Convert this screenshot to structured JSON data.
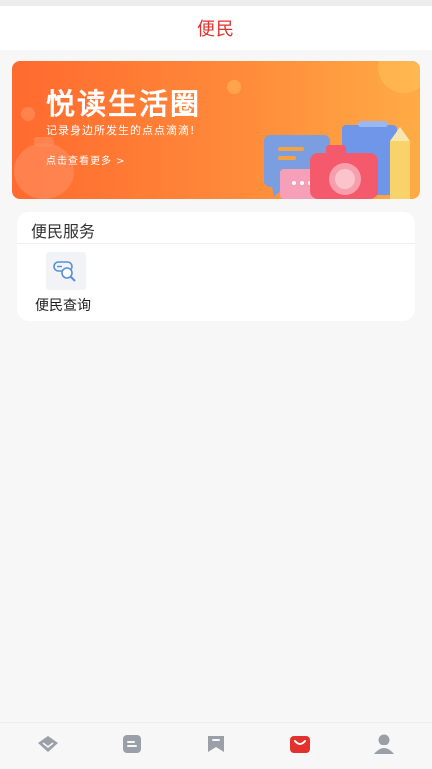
{
  "header": {
    "title": "便民"
  },
  "banner": {
    "headline": "悦读生活圈",
    "subtitle": "记录身边所发生的点点滴滴!",
    "more_link": "点击查看更多 >"
  },
  "section": {
    "title": "便民服务",
    "items": [
      {
        "label": "便民查询",
        "icon": "search-query-icon"
      }
    ]
  },
  "tab_bar": {
    "items": [
      {
        "icon": "diamond-icon",
        "active": false
      },
      {
        "icon": "document-icon",
        "active": false
      },
      {
        "icon": "bookmark-icon",
        "active": false
      },
      {
        "icon": "shopping-bag-icon",
        "active": true
      },
      {
        "icon": "user-icon",
        "active": false
      }
    ],
    "active_color": "#e3312d",
    "inactive_color": "#9a9fa8"
  },
  "colors": {
    "brand": "#e3312d",
    "banner_start": "#ff6a2e",
    "banner_end": "#ffab45"
  }
}
